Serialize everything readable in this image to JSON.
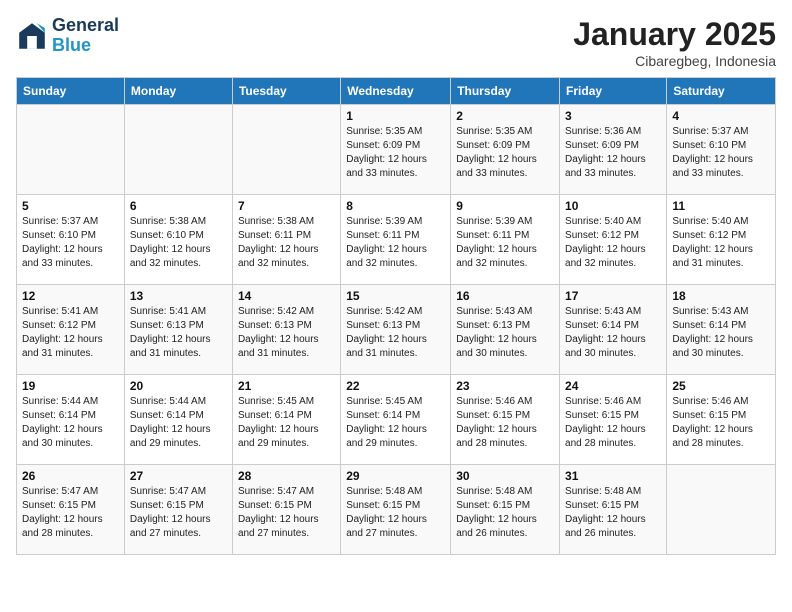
{
  "logo": {
    "line1": "General",
    "line2": "Blue"
  },
  "title": "January 2025",
  "location": "Cibaregbeg, Indonesia",
  "days_of_week": [
    "Sunday",
    "Monday",
    "Tuesday",
    "Wednesday",
    "Thursday",
    "Friday",
    "Saturday"
  ],
  "weeks": [
    [
      {
        "day": "",
        "info": ""
      },
      {
        "day": "",
        "info": ""
      },
      {
        "day": "",
        "info": ""
      },
      {
        "day": "1",
        "info": "Sunrise: 5:35 AM\nSunset: 6:09 PM\nDaylight: 12 hours\nand 33 minutes."
      },
      {
        "day": "2",
        "info": "Sunrise: 5:35 AM\nSunset: 6:09 PM\nDaylight: 12 hours\nand 33 minutes."
      },
      {
        "day": "3",
        "info": "Sunrise: 5:36 AM\nSunset: 6:09 PM\nDaylight: 12 hours\nand 33 minutes."
      },
      {
        "day": "4",
        "info": "Sunrise: 5:37 AM\nSunset: 6:10 PM\nDaylight: 12 hours\nand 33 minutes."
      }
    ],
    [
      {
        "day": "5",
        "info": "Sunrise: 5:37 AM\nSunset: 6:10 PM\nDaylight: 12 hours\nand 33 minutes."
      },
      {
        "day": "6",
        "info": "Sunrise: 5:38 AM\nSunset: 6:10 PM\nDaylight: 12 hours\nand 32 minutes."
      },
      {
        "day": "7",
        "info": "Sunrise: 5:38 AM\nSunset: 6:11 PM\nDaylight: 12 hours\nand 32 minutes."
      },
      {
        "day": "8",
        "info": "Sunrise: 5:39 AM\nSunset: 6:11 PM\nDaylight: 12 hours\nand 32 minutes."
      },
      {
        "day": "9",
        "info": "Sunrise: 5:39 AM\nSunset: 6:11 PM\nDaylight: 12 hours\nand 32 minutes."
      },
      {
        "day": "10",
        "info": "Sunrise: 5:40 AM\nSunset: 6:12 PM\nDaylight: 12 hours\nand 32 minutes."
      },
      {
        "day": "11",
        "info": "Sunrise: 5:40 AM\nSunset: 6:12 PM\nDaylight: 12 hours\nand 31 minutes."
      }
    ],
    [
      {
        "day": "12",
        "info": "Sunrise: 5:41 AM\nSunset: 6:12 PM\nDaylight: 12 hours\nand 31 minutes."
      },
      {
        "day": "13",
        "info": "Sunrise: 5:41 AM\nSunset: 6:13 PM\nDaylight: 12 hours\nand 31 minutes."
      },
      {
        "day": "14",
        "info": "Sunrise: 5:42 AM\nSunset: 6:13 PM\nDaylight: 12 hours\nand 31 minutes."
      },
      {
        "day": "15",
        "info": "Sunrise: 5:42 AM\nSunset: 6:13 PM\nDaylight: 12 hours\nand 31 minutes."
      },
      {
        "day": "16",
        "info": "Sunrise: 5:43 AM\nSunset: 6:13 PM\nDaylight: 12 hours\nand 30 minutes."
      },
      {
        "day": "17",
        "info": "Sunrise: 5:43 AM\nSunset: 6:14 PM\nDaylight: 12 hours\nand 30 minutes."
      },
      {
        "day": "18",
        "info": "Sunrise: 5:43 AM\nSunset: 6:14 PM\nDaylight: 12 hours\nand 30 minutes."
      }
    ],
    [
      {
        "day": "19",
        "info": "Sunrise: 5:44 AM\nSunset: 6:14 PM\nDaylight: 12 hours\nand 30 minutes."
      },
      {
        "day": "20",
        "info": "Sunrise: 5:44 AM\nSunset: 6:14 PM\nDaylight: 12 hours\nand 29 minutes."
      },
      {
        "day": "21",
        "info": "Sunrise: 5:45 AM\nSunset: 6:14 PM\nDaylight: 12 hours\nand 29 minutes."
      },
      {
        "day": "22",
        "info": "Sunrise: 5:45 AM\nSunset: 6:14 PM\nDaylight: 12 hours\nand 29 minutes."
      },
      {
        "day": "23",
        "info": "Sunrise: 5:46 AM\nSunset: 6:15 PM\nDaylight: 12 hours\nand 28 minutes."
      },
      {
        "day": "24",
        "info": "Sunrise: 5:46 AM\nSunset: 6:15 PM\nDaylight: 12 hours\nand 28 minutes."
      },
      {
        "day": "25",
        "info": "Sunrise: 5:46 AM\nSunset: 6:15 PM\nDaylight: 12 hours\nand 28 minutes."
      }
    ],
    [
      {
        "day": "26",
        "info": "Sunrise: 5:47 AM\nSunset: 6:15 PM\nDaylight: 12 hours\nand 28 minutes."
      },
      {
        "day": "27",
        "info": "Sunrise: 5:47 AM\nSunset: 6:15 PM\nDaylight: 12 hours\nand 27 minutes."
      },
      {
        "day": "28",
        "info": "Sunrise: 5:47 AM\nSunset: 6:15 PM\nDaylight: 12 hours\nand 27 minutes."
      },
      {
        "day": "29",
        "info": "Sunrise: 5:48 AM\nSunset: 6:15 PM\nDaylight: 12 hours\nand 27 minutes."
      },
      {
        "day": "30",
        "info": "Sunrise: 5:48 AM\nSunset: 6:15 PM\nDaylight: 12 hours\nand 26 minutes."
      },
      {
        "day": "31",
        "info": "Sunrise: 5:48 AM\nSunset: 6:15 PM\nDaylight: 12 hours\nand 26 minutes."
      },
      {
        "day": "",
        "info": ""
      }
    ]
  ]
}
